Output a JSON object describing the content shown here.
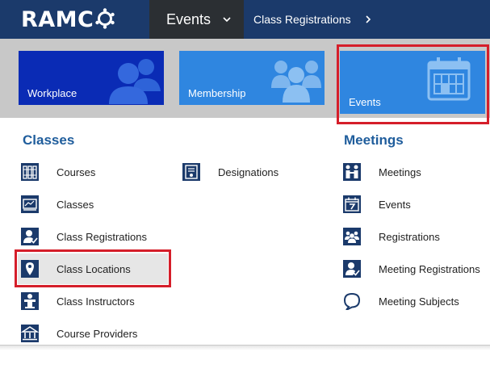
{
  "colors": {
    "topbar": "#1b3a6b",
    "events_nav": "#2b2f33",
    "tile_workplace": "#0a2bb5",
    "tile_blue": "#2f86e0",
    "icon_navy": "#1b3a6b",
    "section_title": "#1f5d9c",
    "highlight": "#d51e2a",
    "selected_row": "#e6e6e6"
  },
  "header": {
    "logo_text": "RAMC",
    "nav_events": {
      "label": "Events",
      "icon": "chevron-down-icon"
    },
    "breadcrumb": {
      "label": "Class Registrations",
      "icon": "chevron-right-icon"
    }
  },
  "tiles": [
    {
      "label": "Workplace",
      "icon": "users-icon"
    },
    {
      "label": "Membership",
      "icon": "group-icon"
    },
    {
      "label": "Events",
      "icon": "calendar-icon",
      "highlighted": true
    }
  ],
  "classes": {
    "title": "Classes",
    "items": [
      {
        "label": "Courses",
        "icon": "books-icon"
      },
      {
        "label": "Classes",
        "icon": "chalkboard-icon"
      },
      {
        "label": "Class Registrations",
        "icon": "person-check-icon"
      },
      {
        "label": "Class Locations",
        "icon": "location-pin-icon",
        "selected": true
      },
      {
        "label": "Class Instructors",
        "icon": "lectern-icon"
      },
      {
        "label": "Course Providers",
        "icon": "building-icon"
      }
    ],
    "extra_items": [
      {
        "label": "Designations",
        "icon": "certificate-icon"
      }
    ]
  },
  "meetings": {
    "title": "Meetings",
    "items": [
      {
        "label": "Meetings",
        "icon": "handshake-icon"
      },
      {
        "label": "Events",
        "icon": "calendar-7-icon"
      },
      {
        "label": "Registrations",
        "icon": "group-icon"
      },
      {
        "label": "Meeting Registrations",
        "icon": "person-check-icon"
      },
      {
        "label": "Meeting Subjects",
        "icon": "speech-bubble-icon"
      }
    ]
  }
}
